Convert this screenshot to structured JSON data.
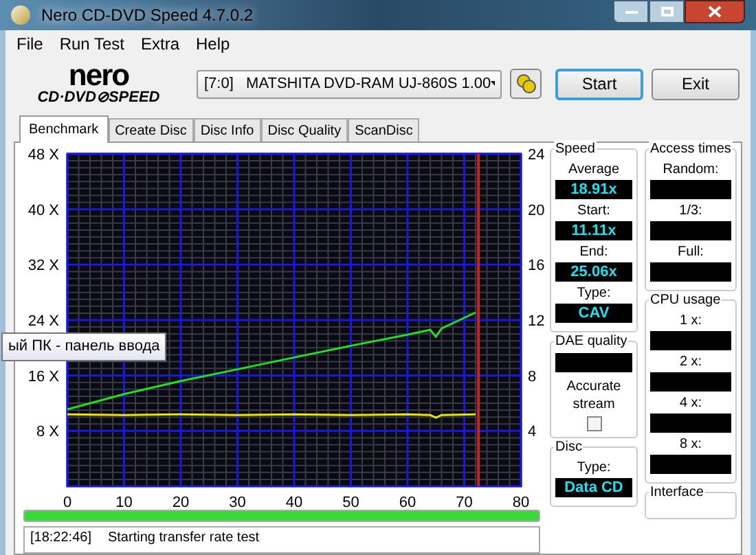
{
  "window": {
    "title": "Nero CD-DVD Speed 4.7.0.2"
  },
  "menu": [
    "File",
    "Run Test",
    "Extra",
    "Help"
  ],
  "logo": {
    "line_1": "nero",
    "line_2": "CD·DVD⊘SPEED"
  },
  "drive_select": {
    "value": "[7:0]   MATSHITA DVD-RAM UJ-860S 1.00"
  },
  "buttons": [
    {
      "label": "Start",
      "selected": true
    },
    {
      "label": "Exit",
      "selected": false
    }
  ],
  "tabs": [
    {
      "label": "Benchmark",
      "selected": true
    },
    {
      "label": "Create Disc",
      "selected": false
    },
    {
      "label": "Disc Info",
      "selected": false
    },
    {
      "label": "Disc Quality",
      "selected": false
    },
    {
      "label": "ScanDisc",
      "selected": false
    }
  ],
  "chart": {
    "chart_data": {
      "type": "line",
      "xlim": [
        0,
        80
      ],
      "ylim": [
        0,
        48
      ],
      "xticks": [
        0,
        10,
        20,
        30,
        40,
        50,
        60,
        70,
        80
      ],
      "yticks": [
        {
          "value": 8,
          "label": "8 X"
        },
        {
          "value": 16,
          "label": "16 X"
        },
        {
          "value": 24,
          "label": "24 X"
        },
        {
          "value": 32,
          "label": "32 X"
        },
        {
          "value": 40,
          "label": "40 X"
        },
        {
          "value": 48,
          "label": "48 X"
        }
      ],
      "y2lim": [
        0,
        24
      ],
      "y2ticks": [
        4,
        8,
        12,
        16,
        20,
        24
      ],
      "grid": true,
      "x": [
        0,
        10,
        20,
        30,
        40,
        50,
        60,
        64,
        65,
        66,
        72
      ],
      "series": [
        {
          "color": "#22dd22",
          "values": [
            11.1,
            13.3,
            15.2,
            16.9,
            18.6,
            20.3,
            21.9,
            22.6,
            21.6,
            22.8,
            25.1
          ]
        },
        {
          "color": "#e8e800",
          "values": [
            10.4,
            10.3,
            10.4,
            10.3,
            10.4,
            10.3,
            10.4,
            10.3,
            9.9,
            10.3,
            10.4
          ]
        }
      ],
      "ref_lines": [
        {
          "axis": "x",
          "value": 72.5,
          "color": "#cc2222"
        }
      ]
    }
  },
  "tooltip": "ый ПК - панель ввода",
  "progress": {
    "level": 1
  },
  "log": {
    "time": "[18:22:46]",
    "message": "Starting transfer rate test"
  },
  "speed": {
    "title": "Speed",
    "fields": [
      {
        "label": "Average",
        "value": "18.91x"
      },
      {
        "label": "Start:",
        "value": "11.11x"
      },
      {
        "label": "End:",
        "value": "25.06x"
      },
      {
        "label": "Type:",
        "value": "CAV"
      }
    ]
  },
  "dae_quality": {
    "title": "DAE quality",
    "accurate_stream": {
      "label": "Accurate stream",
      "checked": false
    }
  },
  "disc": {
    "title": "Disc",
    "type_label": "Type:",
    "type_value": "Data CD"
  },
  "access_times": {
    "title": "Access times",
    "fields": [
      "Random:",
      "1/3:",
      "Full:"
    ]
  },
  "cpu_usage": {
    "title": "CPU usage",
    "fields": [
      "1 x:",
      "2 x:",
      "4 x:",
      "8 x:"
    ]
  },
  "interface": {
    "title": "Interface"
  }
}
